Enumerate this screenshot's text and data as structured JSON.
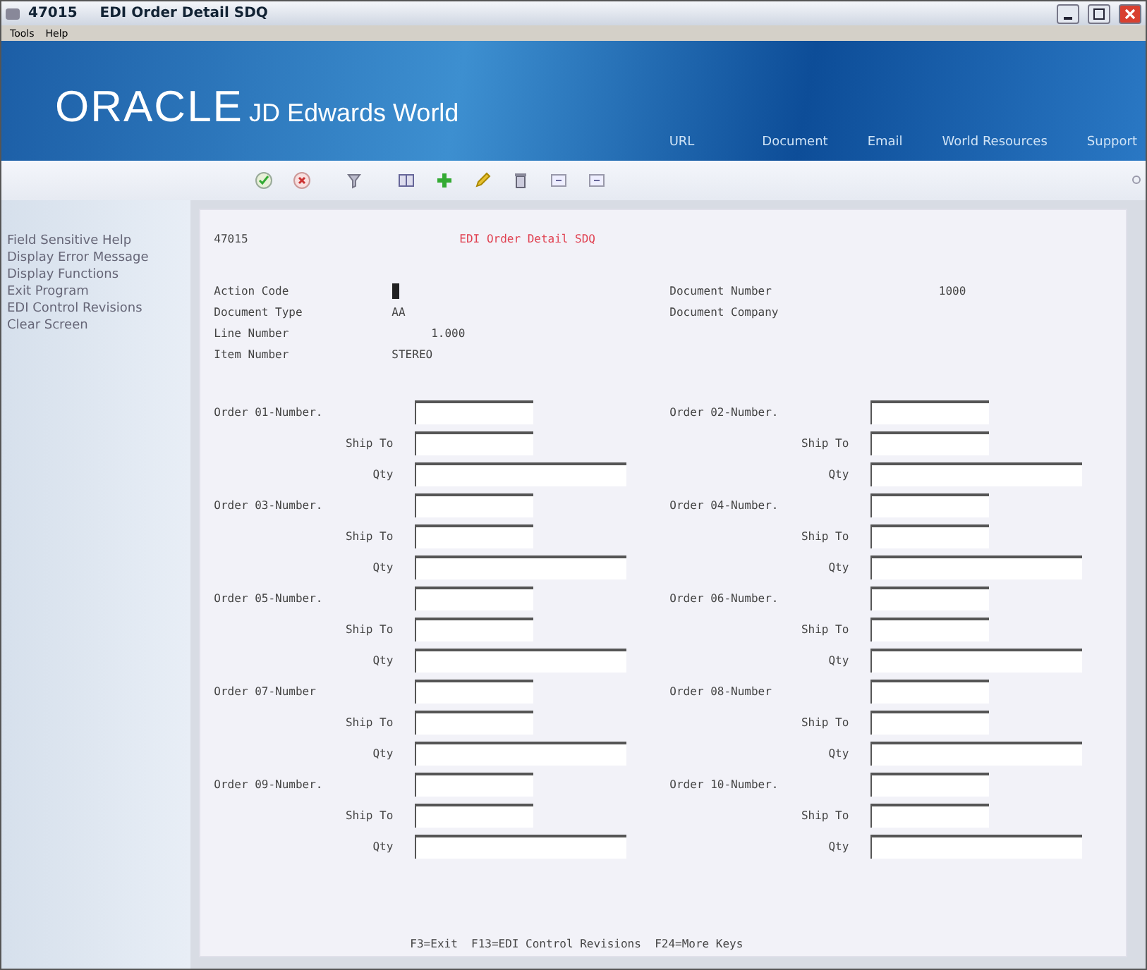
{
  "window": {
    "program": "47015",
    "title": "EDI Order Detail SDQ"
  },
  "menu": [
    "Tools",
    "Help"
  ],
  "banner": {
    "brand": "ORACLE",
    "product": "JD Edwards World",
    "links": [
      "URL",
      "Document",
      "Email",
      "World Resources",
      "Support"
    ]
  },
  "sidebar": {
    "items": [
      "Field Sensitive Help",
      "Display Error Message",
      "Display Functions",
      "Exit Program",
      "EDI Control Revisions",
      "Clear Screen"
    ]
  },
  "form": {
    "program": "47015",
    "title": "EDI Order Detail SDQ",
    "left_fields": [
      {
        "label": "Action Code",
        "kind": "cursor"
      },
      {
        "label": "Document Type",
        "value": "AA",
        "kind": "text"
      },
      {
        "label": "Line Number",
        "value": "1.000",
        "kind": "number"
      },
      {
        "label": "Item Number",
        "value": "STEREO",
        "kind": "text"
      }
    ],
    "right_fields": [
      {
        "label": "Document Number",
        "value": "1000",
        "kind": "number"
      },
      {
        "label": "Document Company",
        "kind": "text"
      }
    ],
    "orders": [
      {
        "fields": [
          {
            "kind": "number",
            "label": "Order 01-Number."
          },
          {
            "kind": "ship_to",
            "label": "Ship To"
          },
          {
            "kind": "qty",
            "label": "Qty"
          }
        ]
      },
      {
        "fields": [
          {
            "kind": "number",
            "label": "Order 02-Number."
          },
          {
            "kind": "ship_to",
            "label": "Ship To"
          },
          {
            "kind": "qty",
            "label": "Qty"
          }
        ]
      },
      {
        "fields": [
          {
            "kind": "number",
            "label": "Order 03-Number."
          },
          {
            "kind": "ship_to",
            "label": "Ship To"
          },
          {
            "kind": "qty",
            "label": "Qty"
          }
        ]
      },
      {
        "fields": [
          {
            "kind": "number",
            "label": "Order 04-Number."
          },
          {
            "kind": "ship_to",
            "label": "Ship To"
          },
          {
            "kind": "qty",
            "label": "Qty"
          }
        ]
      },
      {
        "fields": [
          {
            "kind": "number",
            "label": "Order 05-Number."
          },
          {
            "kind": "ship_to",
            "label": "Ship To"
          },
          {
            "kind": "qty",
            "label": "Qty"
          }
        ]
      },
      {
        "fields": [
          {
            "kind": "number",
            "label": "Order 06-Number."
          },
          {
            "kind": "ship_to",
            "label": "Ship To"
          },
          {
            "kind": "qty",
            "label": "Qty"
          }
        ]
      },
      {
        "fields": [
          {
            "kind": "number",
            "label": "Order 07-Number"
          },
          {
            "kind": "ship_to",
            "label": "Ship To"
          },
          {
            "kind": "qty",
            "label": "Qty"
          }
        ]
      },
      {
        "fields": [
          {
            "kind": "number",
            "label": "Order 08-Number"
          },
          {
            "kind": "ship_to",
            "label": "Ship To"
          },
          {
            "kind": "qty",
            "label": "Qty"
          }
        ]
      },
      {
        "fields": [
          {
            "kind": "number",
            "label": "Order 09-Number."
          },
          {
            "kind": "ship_to",
            "label": "Ship To"
          },
          {
            "kind": "qty",
            "label": "Qty"
          }
        ]
      },
      {
        "fields": [
          {
            "kind": "number",
            "label": "Order 10-Number."
          },
          {
            "kind": "ship_to",
            "label": "Ship To"
          },
          {
            "kind": "qty",
            "label": "Qty"
          }
        ]
      }
    ],
    "function_keys": "F3=Exit  F13=EDI Control Revisions  F24=More Keys"
  }
}
